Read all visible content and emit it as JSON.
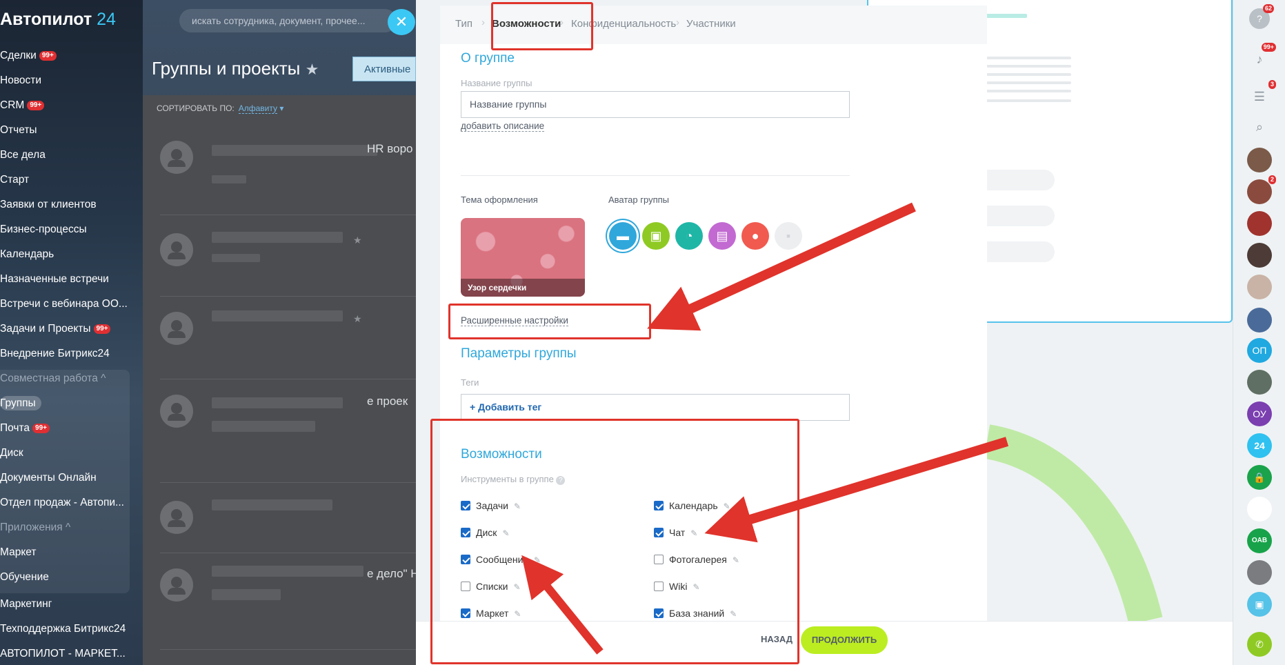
{
  "app": {
    "logo_text": "Автопилот",
    "logo_num": "24"
  },
  "sidebar": {
    "items": [
      {
        "label": "Сделки",
        "badge": "99+"
      },
      {
        "label": "Новости"
      },
      {
        "label": "CRM",
        "badge": "99+"
      },
      {
        "label": "Отчеты"
      },
      {
        "label": "Все дела"
      },
      {
        "label": "Старт"
      },
      {
        "label": "Заявки от клиентов"
      },
      {
        "label": "Бизнес-процессы"
      },
      {
        "label": "Календарь"
      },
      {
        "label": "Назначенные встречи"
      },
      {
        "label": "Встречи с вебинара ОО..."
      },
      {
        "label": "Задачи и Проекты",
        "badge": "99+"
      },
      {
        "label": "Внедрение Битрикс24"
      },
      {
        "label": "Совместная работа ^"
      },
      {
        "label": "Группы"
      },
      {
        "label": "Почта",
        "badge": "99+"
      },
      {
        "label": "Диск"
      },
      {
        "label": "Документы Онлайн"
      },
      {
        "label": "Отдел продаж - Автопи..."
      },
      {
        "label": "Приложения ^"
      },
      {
        "label": "Маркет"
      },
      {
        "label": "Обучение"
      },
      {
        "label": "Маркетинг"
      },
      {
        "label": "Техподдержка Битрикс24"
      },
      {
        "label": "АВТОПИЛОТ - МАРКЕТ..."
      }
    ]
  },
  "header": {
    "search_placeholder": "искать сотрудника, документ, прочее...",
    "close_glyph": "✕",
    "page_title": "Группы и проекты",
    "filter_label": "Активные",
    "sort_label": "СОРТИРОВАТЬ ПО:",
    "sort_value": "Алфавиту",
    "group_rows": [
      {
        "name_tail": "HR воро"
      },
      {
        "name_tail": ""
      },
      {
        "name_tail": ""
      },
      {
        "name_tail": "е проек"
      },
      {
        "name_tail": ""
      },
      {
        "name_tail": "е дело\" Н"
      }
    ]
  },
  "form": {
    "steps": [
      "Тип",
      "Возможности",
      "Конфиденциальность",
      "Участники"
    ],
    "about_title": "О группе",
    "name_label": "Название группы",
    "name_value": "Название группы",
    "add_description": "добавить описание",
    "theme_label": "Тема оформления",
    "theme_caption": "Узор сердечки",
    "avatar_label": "Аватар группы",
    "advanced_link": "Расширенные настройки",
    "params_title": "Параметры группы",
    "tags_label": "Теги",
    "add_tag": "+ Добавить тег",
    "features_title": "Возможности",
    "tools_label": "Инструменты в группе",
    "tools_left": [
      {
        "label": "Задачи",
        "checked": true
      },
      {
        "label": "Диск",
        "checked": true
      },
      {
        "label": "Сообщения",
        "checked": true
      },
      {
        "label": "Списки",
        "checked": false
      },
      {
        "label": "Маркет",
        "checked": true
      }
    ],
    "tools_right": [
      {
        "label": "Календарь",
        "checked": true
      },
      {
        "label": "Чат",
        "checked": true
      },
      {
        "label": "Фотогалерея",
        "checked": false
      },
      {
        "label": "Wiki",
        "checked": false
      },
      {
        "label": "База знаний",
        "checked": true
      }
    ],
    "back_button": "НАЗАД",
    "continue_button": "ПРОДОЛЖИТЬ"
  },
  "rightbar": {
    "badges": [
      "62",
      "99+",
      "3",
      "2"
    ],
    "avatars": [
      "ОП",
      "ОУ",
      "24",
      "OAB"
    ]
  },
  "colors": {
    "accent": "#2fa7db",
    "annotation": "#e0332b",
    "continue": "#bbed21",
    "badge": "#e02f32"
  }
}
